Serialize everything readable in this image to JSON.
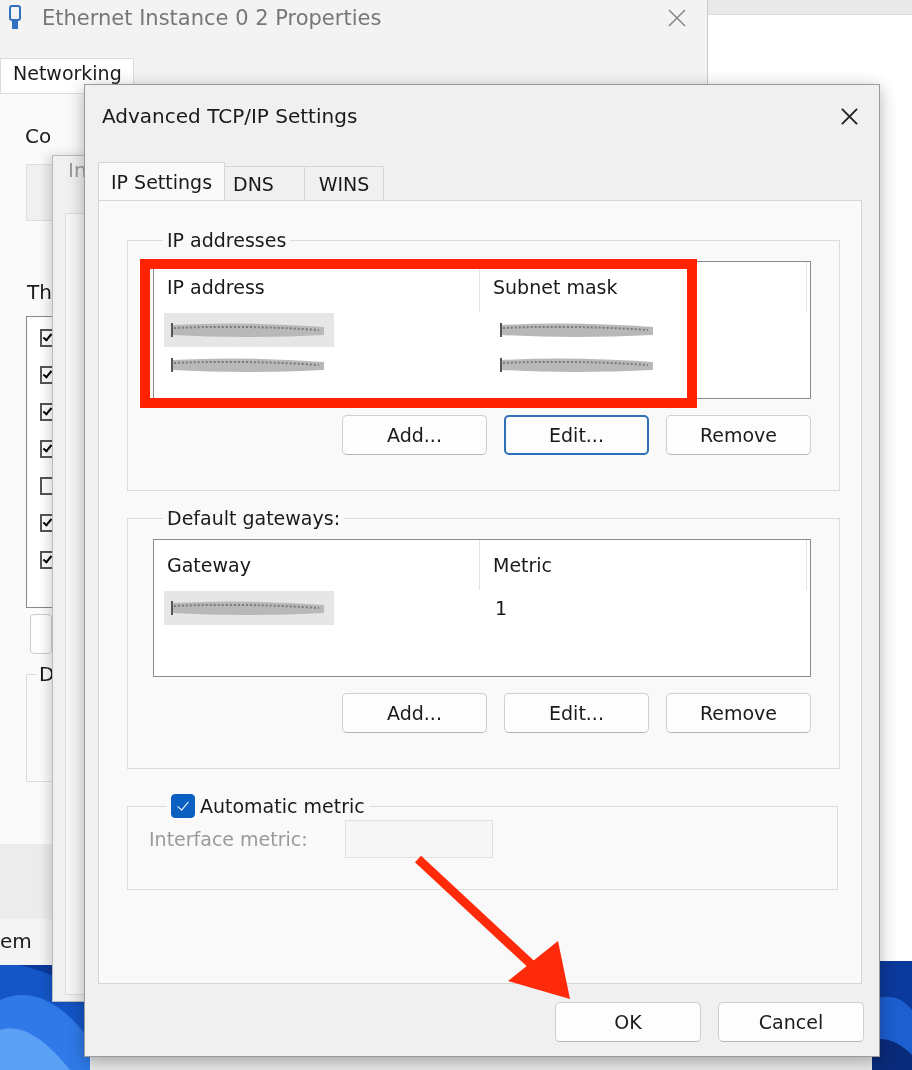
{
  "back_window": {
    "title": "Ethernet Instance 0 2 Properties",
    "tab": "Networking",
    "connect_label": "Co",
    "list_label": "Th",
    "components": [
      {
        "checked": true
      },
      {
        "checked": true
      },
      {
        "checked": true
      },
      {
        "checked": true
      },
      {
        "checked": false
      },
      {
        "checked": true
      },
      {
        "checked": true
      }
    ],
    "group_label": "D",
    "footer_text": "em"
  },
  "middle_window": {
    "title": "In"
  },
  "dialog": {
    "title": "Advanced TCP/IP Settings",
    "tabs": [
      {
        "label": "IP Settings",
        "selected": true
      },
      {
        "label": "DNS",
        "selected": false
      },
      {
        "label": "WINS",
        "selected": false
      }
    ],
    "ip_addresses": {
      "title": "IP addresses",
      "columns": [
        "IP address",
        "Subnet mask"
      ],
      "rows": [
        {
          "selected": true,
          "cells": [
            {
              "kind": "redacted"
            },
            {
              "kind": "redacted"
            }
          ]
        },
        {
          "selected": false,
          "cells": [
            {
              "kind": "redacted"
            },
            {
              "kind": "redacted"
            }
          ]
        }
      ],
      "buttons": [
        {
          "label": "Add...",
          "focused": false
        },
        {
          "label": "Edit...",
          "focused": true
        },
        {
          "label": "Remove",
          "focused": false
        }
      ]
    },
    "default_gateways": {
      "title": "Default gateways:",
      "columns": [
        "Gateway",
        "Metric"
      ],
      "rows": [
        {
          "selected": true,
          "cells": [
            {
              "kind": "redacted"
            },
            {
              "kind": "text",
              "text": "1"
            }
          ]
        }
      ],
      "buttons": [
        {
          "label": "Add...",
          "focused": false
        },
        {
          "label": "Edit...",
          "focused": false
        },
        {
          "label": "Remove",
          "focused": false
        }
      ]
    },
    "automatic_metric": {
      "label": "Automatic metric",
      "checked": true
    },
    "interface_metric": {
      "label": "Interface metric:",
      "disabled": true
    },
    "buttons": [
      {
        "label": "OK"
      },
      {
        "label": "Cancel"
      }
    ]
  }
}
